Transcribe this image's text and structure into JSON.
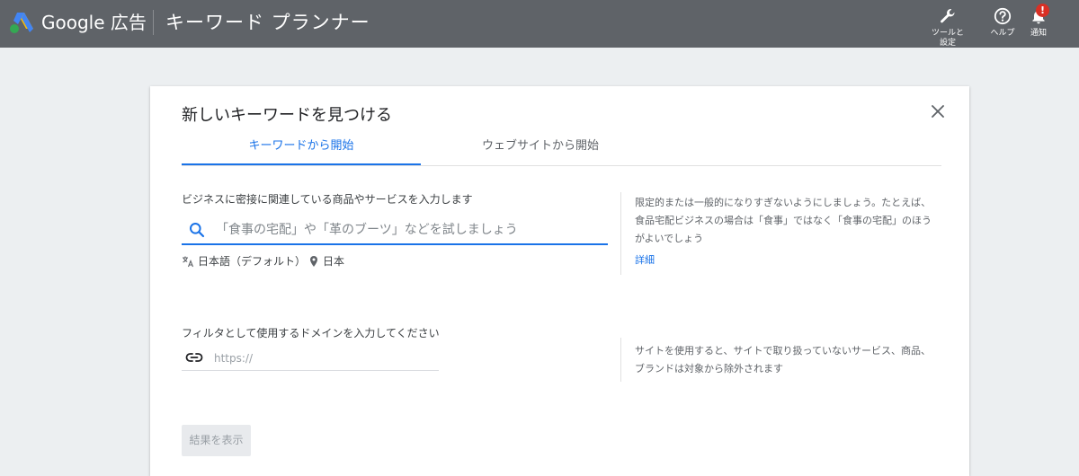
{
  "header": {
    "brand": "Google 広告",
    "tool_title": "キーワード プランナー",
    "actions": {
      "tools_label": "ツールと設定",
      "help_label": "ヘルプ",
      "notifications_label": "通知",
      "notifications_badge": "!"
    }
  },
  "dialog": {
    "title": "新しいキーワードを見つける",
    "tabs": [
      {
        "label": "キーワードから開始",
        "active": true
      },
      {
        "label": "ウェブサイトから開始",
        "active": false
      }
    ],
    "keyword_section": {
      "label": "ビジネスに密接に関連している商品やサービスを入力します",
      "placeholder": "「食事の宅配」や「革のブーツ」などを試しましょう",
      "language": "日本語（デフォルト）",
      "location": "日本",
      "hint": "限定的または一般的になりすぎないようにしましょう。たとえば、食品宅配ビジネスの場合は「食事」ではなく「食事の宅配」のほうがよいでしょう",
      "hint_link": "詳細"
    },
    "domain_section": {
      "label": "フィルタとして使用するドメインを入力してください",
      "placeholder": "https://",
      "hint": "サイトを使用すると、サイトで取り扱っていないサービス、商品、ブランドは対象から除外されます"
    },
    "submit_label": "結果を表示"
  },
  "colors": {
    "topbar": "#5f6368",
    "accent": "#1a73e8",
    "badge": "#d93025",
    "background": "#eceff1"
  },
  "icons": [
    "google-ads-logo-icon",
    "wrench-icon",
    "help-icon",
    "bell-icon",
    "close-icon",
    "search-icon",
    "translate-icon",
    "location-pin-icon",
    "link-icon"
  ]
}
